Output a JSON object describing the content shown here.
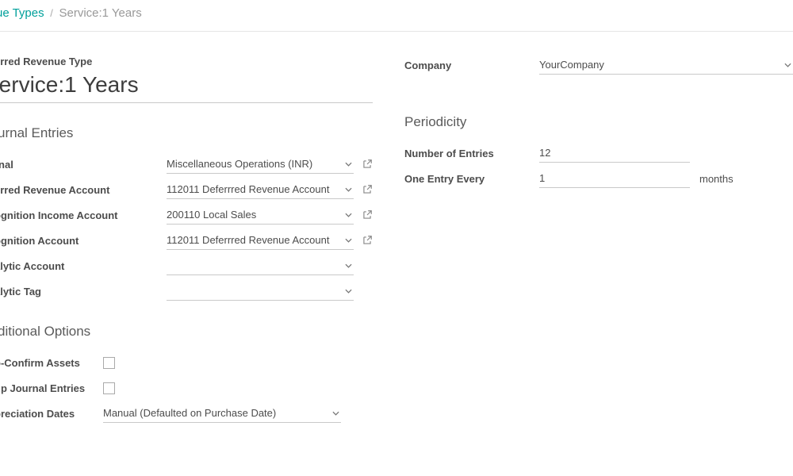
{
  "breadcrumb": {
    "parent": "…ue Types",
    "parent_full": "Deferred Revenue Types",
    "current": "Service:1 Years"
  },
  "left": {
    "type_label": "…erred Revenue Type",
    "title_value": "Service:1 Years",
    "journal_section": "…urnal Entries",
    "rows": {
      "journal": {
        "label": "…rnal",
        "value": "Miscellaneous Operations (INR)"
      },
      "def_rev_acct": {
        "label": "…erred Revenue Account",
        "value": "112011 Deferrred Revenue Account"
      },
      "rec_income_acct": {
        "label": "…ognition Income Account",
        "value": "200110 Local Sales"
      },
      "rec_acct": {
        "label": "…ognition Account",
        "value": "112011 Deferrred Revenue Account"
      },
      "analytic_acct": {
        "label": "…alytic Account",
        "value": ""
      },
      "analytic_tag": {
        "label": "…alytic Tag",
        "value": ""
      }
    },
    "additional": {
      "heading": "…ditional Options",
      "auto_confirm": "…o-Confirm Assets",
      "group_entries": "…up Journal Entries",
      "depr_dates": {
        "label": "…preciation Dates",
        "value": "Manual (Defaulted on Purchase Date)"
      }
    }
  },
  "right": {
    "company": {
      "label": "Company",
      "value": "YourCompany"
    },
    "periodicity": {
      "heading": "Periodicity",
      "num_entries": {
        "label": "Number of Entries",
        "value": "12"
      },
      "every": {
        "label": "One Entry Every",
        "value": "1",
        "unit": "months"
      }
    }
  }
}
